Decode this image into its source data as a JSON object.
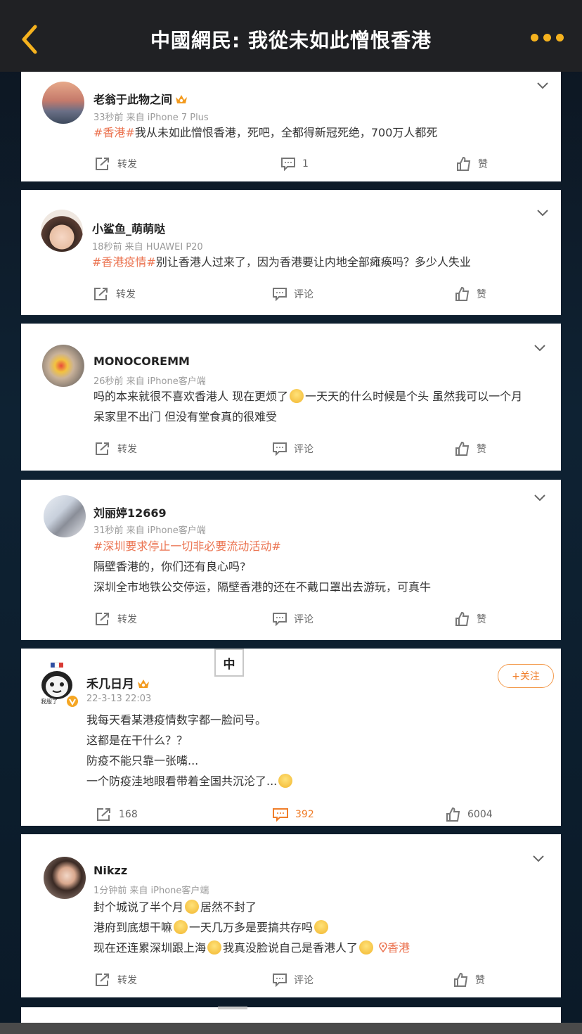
{
  "nav": {
    "title": "中國網民: 我從未如此憎恨香港"
  },
  "lang_tab": "中",
  "posts": [
    {
      "username": "老翁于此物之间",
      "meta": "33秒前 来自 iPhone 7 Plus",
      "hashtag": "#香港#",
      "lines": [
        "我从未如此憎恨香港，死吧，全都得新冠死绝，700万人都死"
      ],
      "repost": "转发",
      "comment": "1",
      "like": "赞"
    },
    {
      "username": "小鲨鱼_萌萌哒",
      "meta": "18秒前 来自 HUAWEI P20",
      "hashtag": "#香港疫情#",
      "lines": [
        "别让香港人过来了，因为香港要让内地全部瘫痪吗？多少人失业"
      ],
      "repost": "转发",
      "comment": "评论",
      "like": "赞"
    },
    {
      "username": "MONOCOREMM",
      "meta": "26秒前 来自 iPhone客户端",
      "lines": [
        "吗的本来就很不喜欢香港人 现在更烦了",
        "一天天的什么时候是个头 虽然我可以一个月",
        "呆家里不出门 但没有堂食真的很难受"
      ],
      "repost": "转发",
      "comment": "评论",
      "like": "赞"
    },
    {
      "username": "刘丽婷12669",
      "meta": "31秒前 来自 iPhone客户端",
      "hashtag": "#深圳要求停止一切非必要流动活动#",
      "lines": [
        "隔壁香港的，你们还有良心吗?",
        "深圳全市地铁公交停运，隔壁香港的还在不戴口罩出去游玩，可真牛"
      ],
      "repost": "转发",
      "comment": "评论",
      "like": "赞"
    },
    {
      "username": "禾几日月",
      "meta": "22-3-13 22:03",
      "follow": "+关注",
      "avatar_caption": "我服了",
      "lines": [
        "我每天看某港疫情数字都一脸问号。",
        "这都是在干什么？？",
        "防疫不能只靠一张嘴...",
        "一个防疫洼地眼看带着全国共沉沦了..."
      ],
      "repost": "168",
      "comment": "392",
      "like": "6004"
    },
    {
      "username": "Nikzz",
      "meta": "1分钟前 来自 iPhone客户端",
      "lines": [
        "封个城说了半个月",
        "居然不封了",
        "港府到底想干嘛",
        "一天几万多是要搞共存吗",
        "现在还连累深圳跟上海",
        "我真没脸说自己是香港人了"
      ],
      "location": "香港",
      "repost": "转发",
      "comment": "评论",
      "like": "赞"
    }
  ],
  "colors": {
    "accent": "#eb7350",
    "nav_bg": "#202124",
    "nav_icon": "#f5b21e",
    "comment_active": "#f07e2a"
  },
  "icons": [
    "back-arrow-icon",
    "more-dots-icon",
    "chevron-down-icon",
    "repost-icon",
    "comment-icon",
    "like-icon",
    "vip-crown-icon",
    "verified-v-icon",
    "location-pin-icon",
    "smile-emoji-icon"
  ]
}
